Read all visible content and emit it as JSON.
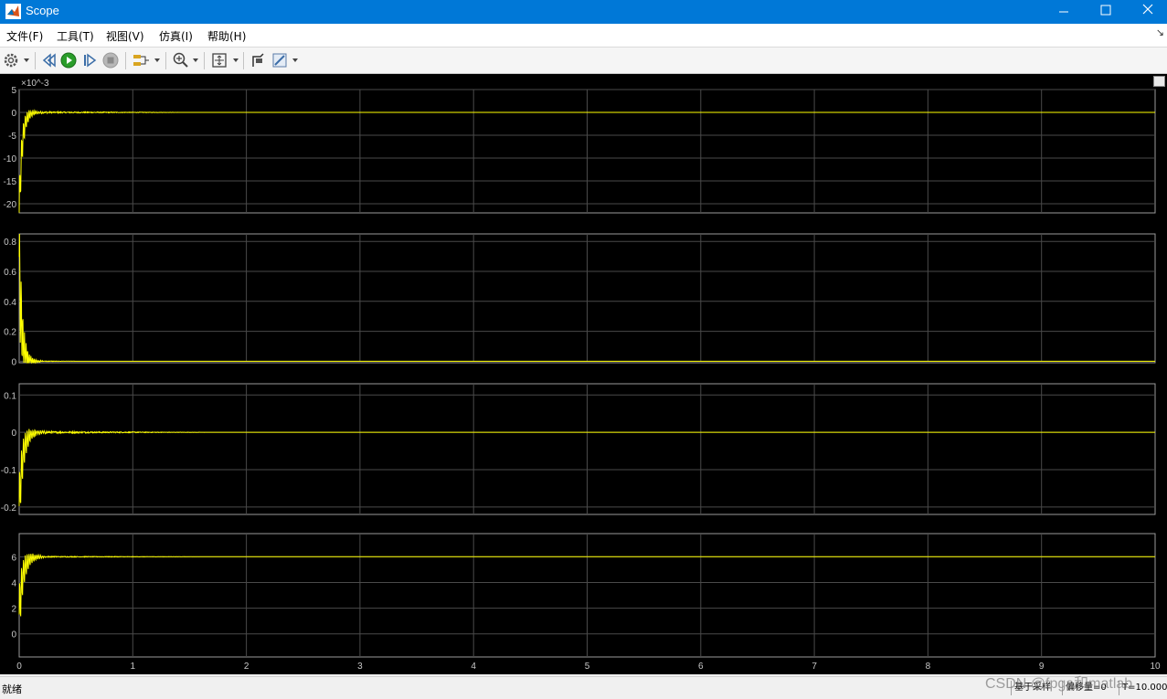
{
  "window": {
    "title": "Scope"
  },
  "menu": [
    {
      "label": "文件(F)"
    },
    {
      "label": "工具(T)"
    },
    {
      "label": "视图(V)"
    },
    {
      "label": "仿真(I)"
    },
    {
      "label": "帮助(H)"
    }
  ],
  "toolbar": {
    "icons": [
      "settings-gear-icon",
      "step-back-icon",
      "run-icon",
      "step-forward-icon",
      "stop-icon",
      "signal-selector-icon",
      "zoom-in-icon",
      "fit-to-view-icon",
      "highlight-block-icon",
      "style-icon"
    ]
  },
  "colors": {
    "plot_bg": "#000000",
    "trace": "#ffff00",
    "grid": "#4a4a4a",
    "axis_text": "#c8c8c8",
    "titlebar": "#0078d7"
  },
  "status": {
    "ready": "就绪",
    "sample_based": "基于采样",
    "offset": "偏移量=0",
    "time": "T=10.000"
  },
  "watermark": "CSDN @fpga和matlab",
  "chart_data": [
    {
      "type": "line",
      "xlim": [
        0,
        10
      ],
      "ylim": [
        -0.022,
        0.005
      ],
      "y_exponent": "×10^-3",
      "ytick_labels": [
        "5",
        "0",
        "-5",
        "-10",
        "-15",
        "-20"
      ],
      "ytick_values": [
        0.005,
        0,
        -0.005,
        -0.01,
        -0.015,
        -0.02
      ],
      "series": [
        {
          "settle": 0,
          "start": -0.022,
          "amp": 0.006,
          "freq": 60,
          "decay": 20,
          "noise": 0.0002,
          "noise_until": 1.5
        }
      ]
    },
    {
      "type": "line",
      "xlim": [
        0,
        10
      ],
      "ylim": [
        -0.01,
        0.85
      ],
      "ytick_labels": [
        "0.8",
        "0.6",
        "0.4",
        "0.2",
        "0"
      ],
      "ytick_values": [
        0.8,
        0.6,
        0.4,
        0.2,
        0
      ],
      "series": [
        {
          "settle": 0,
          "start": 0.7,
          "amp": 0.4,
          "freq": 70,
          "decay": 25,
          "noise": 0.004,
          "noise_until": 0.5
        }
      ]
    },
    {
      "type": "line",
      "xlim": [
        0,
        10
      ],
      "ylim": [
        -0.22,
        0.13
      ],
      "ytick_labels": [
        "0.1",
        "0",
        "-0.1",
        "-0.2"
      ],
      "ytick_values": [
        0.1,
        0,
        -0.1,
        -0.2
      ],
      "series": [
        {
          "settle": 0,
          "start": -0.2,
          "amp": 0.08,
          "freq": 60,
          "decay": 16,
          "noise": 0.003,
          "noise_until": 1.7
        }
      ]
    },
    {
      "type": "line",
      "xlim": [
        0,
        10
      ],
      "ylim": [
        -1.8,
        7.8
      ],
      "ytick_labels": [
        "6",
        "4",
        "2",
        "0"
      ],
      "ytick_values": [
        6,
        4,
        2,
        0
      ],
      "series": [
        {
          "settle": 6,
          "start": 1.5,
          "amp": 2.2,
          "freq": 60,
          "decay": 16,
          "noise": 0.04,
          "noise_until": 1.7
        }
      ]
    }
  ],
  "xtick_labels": [
    "0",
    "1",
    "2",
    "3",
    "4",
    "5",
    "6",
    "7",
    "8",
    "9",
    "10"
  ]
}
